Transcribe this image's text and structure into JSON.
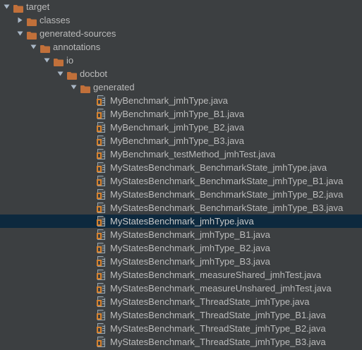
{
  "tree": [
    {
      "label": "target",
      "type": "folder",
      "depth": 0,
      "expanded": true
    },
    {
      "label": "classes",
      "type": "folder",
      "depth": 1,
      "expanded": false
    },
    {
      "label": "generated-sources",
      "type": "folder",
      "depth": 1,
      "expanded": true
    },
    {
      "label": "annotations",
      "type": "folder",
      "depth": 2,
      "expanded": true
    },
    {
      "label": "io",
      "type": "folder",
      "depth": 3,
      "expanded": true
    },
    {
      "label": "docbot",
      "type": "folder",
      "depth": 4,
      "expanded": true
    },
    {
      "label": "generated",
      "type": "folder",
      "depth": 5,
      "expanded": true
    },
    {
      "label": "MyBenchmark_jmhType.java",
      "type": "java-file",
      "depth": 6
    },
    {
      "label": "MyBenchmark_jmhType_B1.java",
      "type": "java-file",
      "depth": 6
    },
    {
      "label": "MyBenchmark_jmhType_B2.java",
      "type": "java-file",
      "depth": 6
    },
    {
      "label": "MyBenchmark_jmhType_B3.java",
      "type": "java-file",
      "depth": 6
    },
    {
      "label": "MyBenchmark_testMethod_jmhTest.java",
      "type": "java-file",
      "depth": 6
    },
    {
      "label": "MyStatesBenchmark_BenchmarkState_jmhType.java",
      "type": "java-file",
      "depth": 6
    },
    {
      "label": "MyStatesBenchmark_BenchmarkState_jmhType_B1.java",
      "type": "java-file",
      "depth": 6
    },
    {
      "label": "MyStatesBenchmark_BenchmarkState_jmhType_B2.java",
      "type": "java-file",
      "depth": 6
    },
    {
      "label": "MyStatesBenchmark_BenchmarkState_jmhType_B3.java",
      "type": "java-file",
      "depth": 6
    },
    {
      "label": "MyStatesBenchmark_jmhType.java",
      "type": "java-file",
      "depth": 6,
      "selected": true
    },
    {
      "label": "MyStatesBenchmark_jmhType_B1.java",
      "type": "java-file",
      "depth": 6
    },
    {
      "label": "MyStatesBenchmark_jmhType_B2.java",
      "type": "java-file",
      "depth": 6
    },
    {
      "label": "MyStatesBenchmark_jmhType_B3.java",
      "type": "java-file",
      "depth": 6
    },
    {
      "label": "MyStatesBenchmark_measureShared_jmhTest.java",
      "type": "java-file",
      "depth": 6
    },
    {
      "label": "MyStatesBenchmark_measureUnshared_jmhTest.java",
      "type": "java-file",
      "depth": 6
    },
    {
      "label": "MyStatesBenchmark_ThreadState_jmhType.java",
      "type": "java-file",
      "depth": 6
    },
    {
      "label": "MyStatesBenchmark_ThreadState_jmhType_B1.java",
      "type": "java-file",
      "depth": 6
    },
    {
      "label": "MyStatesBenchmark_ThreadState_jmhType_B2.java",
      "type": "java-file",
      "depth": 6
    },
    {
      "label": "MyStatesBenchmark_ThreadState_jmhType_B3.java",
      "type": "java-file",
      "depth": 6
    }
  ],
  "colors": {
    "background": "#3c3f41",
    "selection": "#0d293e",
    "text": "#bbbbbb",
    "folder": "#c1703a",
    "arrow": "#a9b7c6"
  },
  "icons": {
    "folder": "folder-icon",
    "file": "java-file-icon",
    "expanded": "chevron-down-icon",
    "collapsed": "chevron-right-icon"
  }
}
